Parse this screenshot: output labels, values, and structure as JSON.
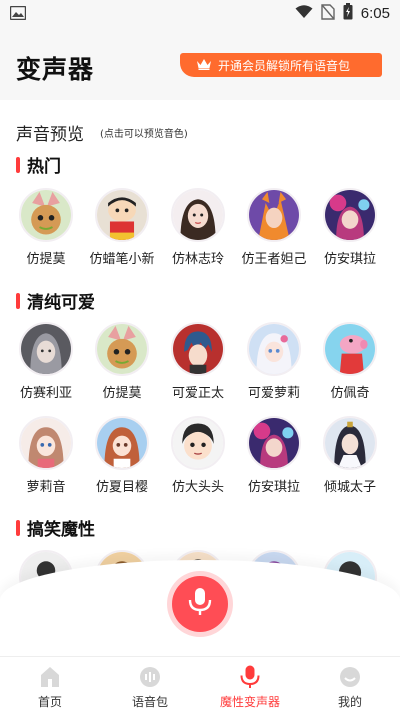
{
  "status_bar": {
    "time": "6:05"
  },
  "header": {
    "title": "变声器",
    "vip_label": "开通会员解锁所有语音包"
  },
  "preview": {
    "title": "声音预览",
    "hint": "(点击可以预览音色)"
  },
  "sections": [
    {
      "title": "热门",
      "items": [
        {
          "label": "仿提莫",
          "icon": "teemo-avatar"
        },
        {
          "label": "仿蜡笔小新",
          "icon": "shinchan-avatar"
        },
        {
          "label": "仿林志玲",
          "icon": "lin-zhiling-avatar"
        },
        {
          "label": "仿王者妲己",
          "icon": "daji-avatar"
        },
        {
          "label": "仿安琪拉",
          "icon": "angela-avatar"
        }
      ]
    },
    {
      "title": "清纯可爱",
      "items": [
        {
          "label": "仿赛利亚",
          "icon": "seria-avatar"
        },
        {
          "label": "仿提莫",
          "icon": "teemo-avatar"
        },
        {
          "label": "可爱正太",
          "icon": "cute-boy-avatar"
        },
        {
          "label": "可爱萝莉",
          "icon": "cute-loli-avatar"
        },
        {
          "label": "仿佩奇",
          "icon": "peppa-avatar"
        },
        {
          "label": "萝莉音",
          "icon": "loli-voice-avatar"
        },
        {
          "label": "仿夏目樱",
          "icon": "natsume-avatar"
        },
        {
          "label": "仿大头头",
          "icon": "big-head-avatar"
        },
        {
          "label": "仿安琪拉",
          "icon": "angela-avatar"
        },
        {
          "label": "倾城太子",
          "icon": "prince-avatar"
        }
      ]
    },
    {
      "title": "搞笑魔性"
    }
  ],
  "nav": {
    "home": "首页",
    "voice_pack": "语音包",
    "voice_changer": "魔性变声器",
    "mine": "我的"
  },
  "colors": {
    "accent": "#ff3b3b",
    "vip": "#ff6b2e",
    "mic": "#ff4d55"
  }
}
